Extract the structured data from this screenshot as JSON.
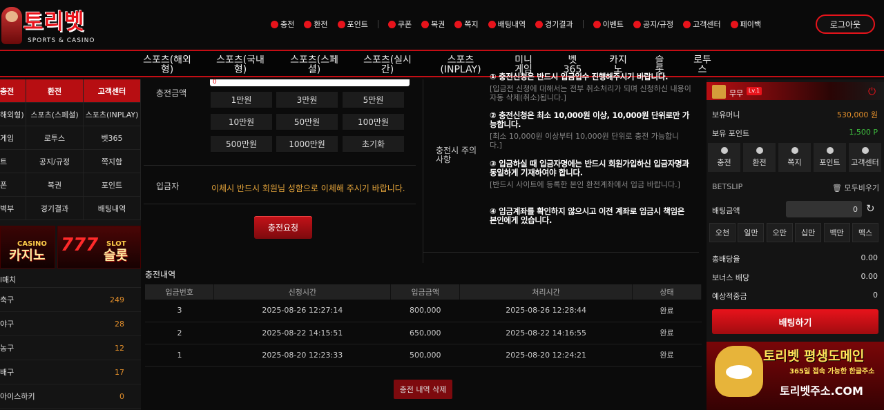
{
  "header": {
    "brand": "토리벳",
    "brand_sub": "SPORTS & CASINO",
    "nav": [
      "충전",
      "환전",
      "포인트",
      "쿠폰",
      "복권",
      "쪽지",
      "배팅내역",
      "경기결과",
      "이벤트",
      "공지/규정",
      "고객센터",
      "페이백"
    ],
    "logout": "로그아웃"
  },
  "menu": [
    "스포츠(해외형)",
    "스포츠(국내형)",
    "스포츠(스페셜)",
    "스포츠(실시간)",
    "스포츠(INPLAY)",
    "미니게임",
    "벳365",
    "카지노",
    "슬롯",
    "로투스"
  ],
  "left": {
    "quick": [
      [
        "충전",
        "환전",
        "고객센터"
      ],
      [
        "해외형)",
        "스포츠(스페셜)",
        "스포츠(INPLAY)"
      ],
      [
        "게임",
        "로투스",
        "벳365"
      ],
      [
        "트",
        "공지/규정",
        "쪽지함"
      ],
      [
        "폰",
        "복권",
        "포인트"
      ],
      [
        "벽부",
        "경기결과",
        "배팅내역"
      ]
    ],
    "banner_casino_top": "CASINO",
    "banner_casino": "카지노",
    "banner_slot_num": "777",
    "banner_slot_top": "SLOT",
    "banner_slot": "슬롯",
    "match_header": "l매치",
    "matches": [
      {
        "name": "축구",
        "count": "249"
      },
      {
        "name": "야구",
        "count": "28"
      },
      {
        "name": "농구",
        "count": "12"
      },
      {
        "name": "배구",
        "count": "17"
      },
      {
        "name": "아이스하키",
        "count": "0"
      }
    ]
  },
  "form": {
    "amount_label": "충전금액",
    "amount_value": "0",
    "amounts": [
      "1만원",
      "3만원",
      "5만원",
      "10만원",
      "50만원",
      "100만원",
      "500만원",
      "1000만원",
      "초기화"
    ],
    "depositor_label": "입금자",
    "depositor_note": "이체시 반드시 회원님 성함으로 이체해 주시기 바랍니다.",
    "request_btn": "충전요청"
  },
  "notes": {
    "label": "충전시 주의사항",
    "n1_title": "① 충전신청은 반드시 입금입수 진행해주시기 바랍니다.",
    "n1_sub": "[입금전 신청에 대해서는 전부 취소처리가 되며 신청하신 내용이 자동 삭제(취소)됩니다.]",
    "n2_title": "② 충전신청은 최소 10,000원 이상, 10,000원 단위로만 가능합니다.",
    "n2_sub": "[최소 10,000원 이상부터 10,000원 단위로 충전 가능합니다.]",
    "n3_title": "③ 입금하실 때 입금자명에는 반드시 회원가입하신 입금자명과 동일하게 기재하여야 합니다.",
    "n3_sub": "[반드시 사이트에 등록한 본인 환전계좌에서 입금 바랍니다.]",
    "n4_title": "④ 입금계좌를 확인하지 않으시고 이전 계좌로 입금시 책임은 본인에게 있습니다."
  },
  "history": {
    "title": "충전내역",
    "columns": [
      "입금번호",
      "신청시간",
      "입금금액",
      "처리시간",
      "상태"
    ],
    "rows": [
      [
        "3",
        "2025-08-26 12:27:14",
        "800,000",
        "2025-08-26 12:28:44",
        "완료"
      ],
      [
        "2",
        "2025-08-22 14:15:51",
        "650,000",
        "2025-08-22 14:16:55",
        "완료"
      ],
      [
        "1",
        "2025-08-20 12:23:33",
        "500,000",
        "2025-08-20 12:24:21",
        "완료"
      ]
    ],
    "delete_btn": "충전 내역 삭제"
  },
  "right": {
    "user": "무무",
    "level": "Lv.1",
    "money_label": "보유머니",
    "money": "530,000 원",
    "point_label": "보유 포인트",
    "point": "1,500 P",
    "icons": [
      "충전",
      "환전",
      "쪽지",
      "포인트",
      "고객센터"
    ],
    "betslip": "BETSLIP",
    "clear_all": "모두비우기",
    "bet_amount_label": "배팅금액",
    "bet_amount": "0",
    "chips": [
      "오천",
      "일만",
      "오만",
      "십만",
      "백만",
      "맥스"
    ],
    "total_odds_label": "총배당율",
    "total_odds": "0.00",
    "bonus_label": "보너스 배당",
    "bonus": "0.00",
    "expected_label": "예상적중금",
    "expected": "0",
    "bet_btn": "배팅하기",
    "promo_title": "토리벳 평생도메인",
    "promo_sub": "365일 접속 가능한 한글주소",
    "promo_url": "토리벳주소.COM"
  }
}
